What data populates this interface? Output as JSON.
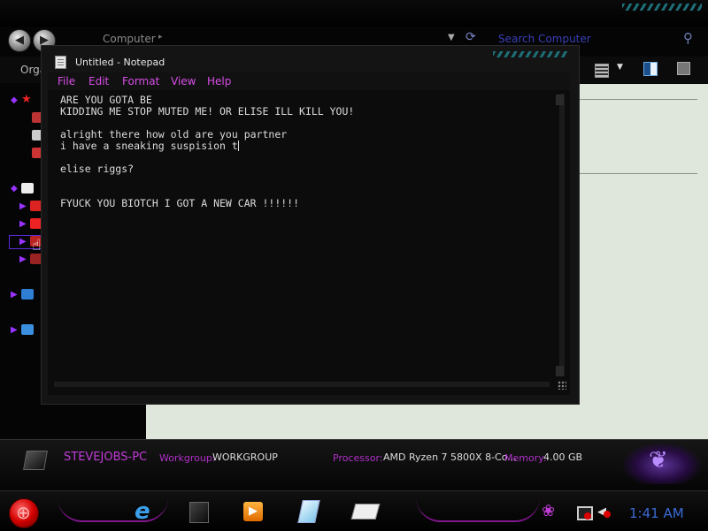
{
  "explorer": {
    "address": "Computer",
    "search_placeholder": "Search Computer",
    "organize_label": "Orga"
  },
  "details": {
    "computer_name": "STEVEJOBS-PC",
    "workgroup_label": "Workgroup:",
    "workgroup_value": "WORKGROUP",
    "processor_label": "Processor:",
    "processor_value": "AMD Ryzen 7 5800X 8-Co...",
    "memory_label": "Memory:",
    "memory_value": "4.00 GB"
  },
  "notepad": {
    "title": "Untitled - Notepad",
    "menu": [
      "File",
      "Edit",
      "Format",
      "View",
      "Help"
    ],
    "lines": [
      "ARE YOU GOTA BE",
      "KIDDING ME STOP MUTED ME! OR ELISE ILL KILL YOU!",
      "",
      "alright there how old are you partner",
      "i have a sneaking suspision t",
      "",
      "elise riggs?",
      "",
      "",
      "FYUCK YOU BIOTCH I GOT A NEW CAR !!!!!!"
    ]
  },
  "taskbar": {
    "clock": "1:41 AM",
    "pinned": [
      "internet-explorer",
      "windows-explorer",
      "media-player",
      "notepad",
      "paint"
    ]
  },
  "icons": {
    "back": "back-arrow-icon",
    "forward": "forward-arrow-icon",
    "search": "magnifier-icon",
    "start": "windows-start-orb"
  }
}
